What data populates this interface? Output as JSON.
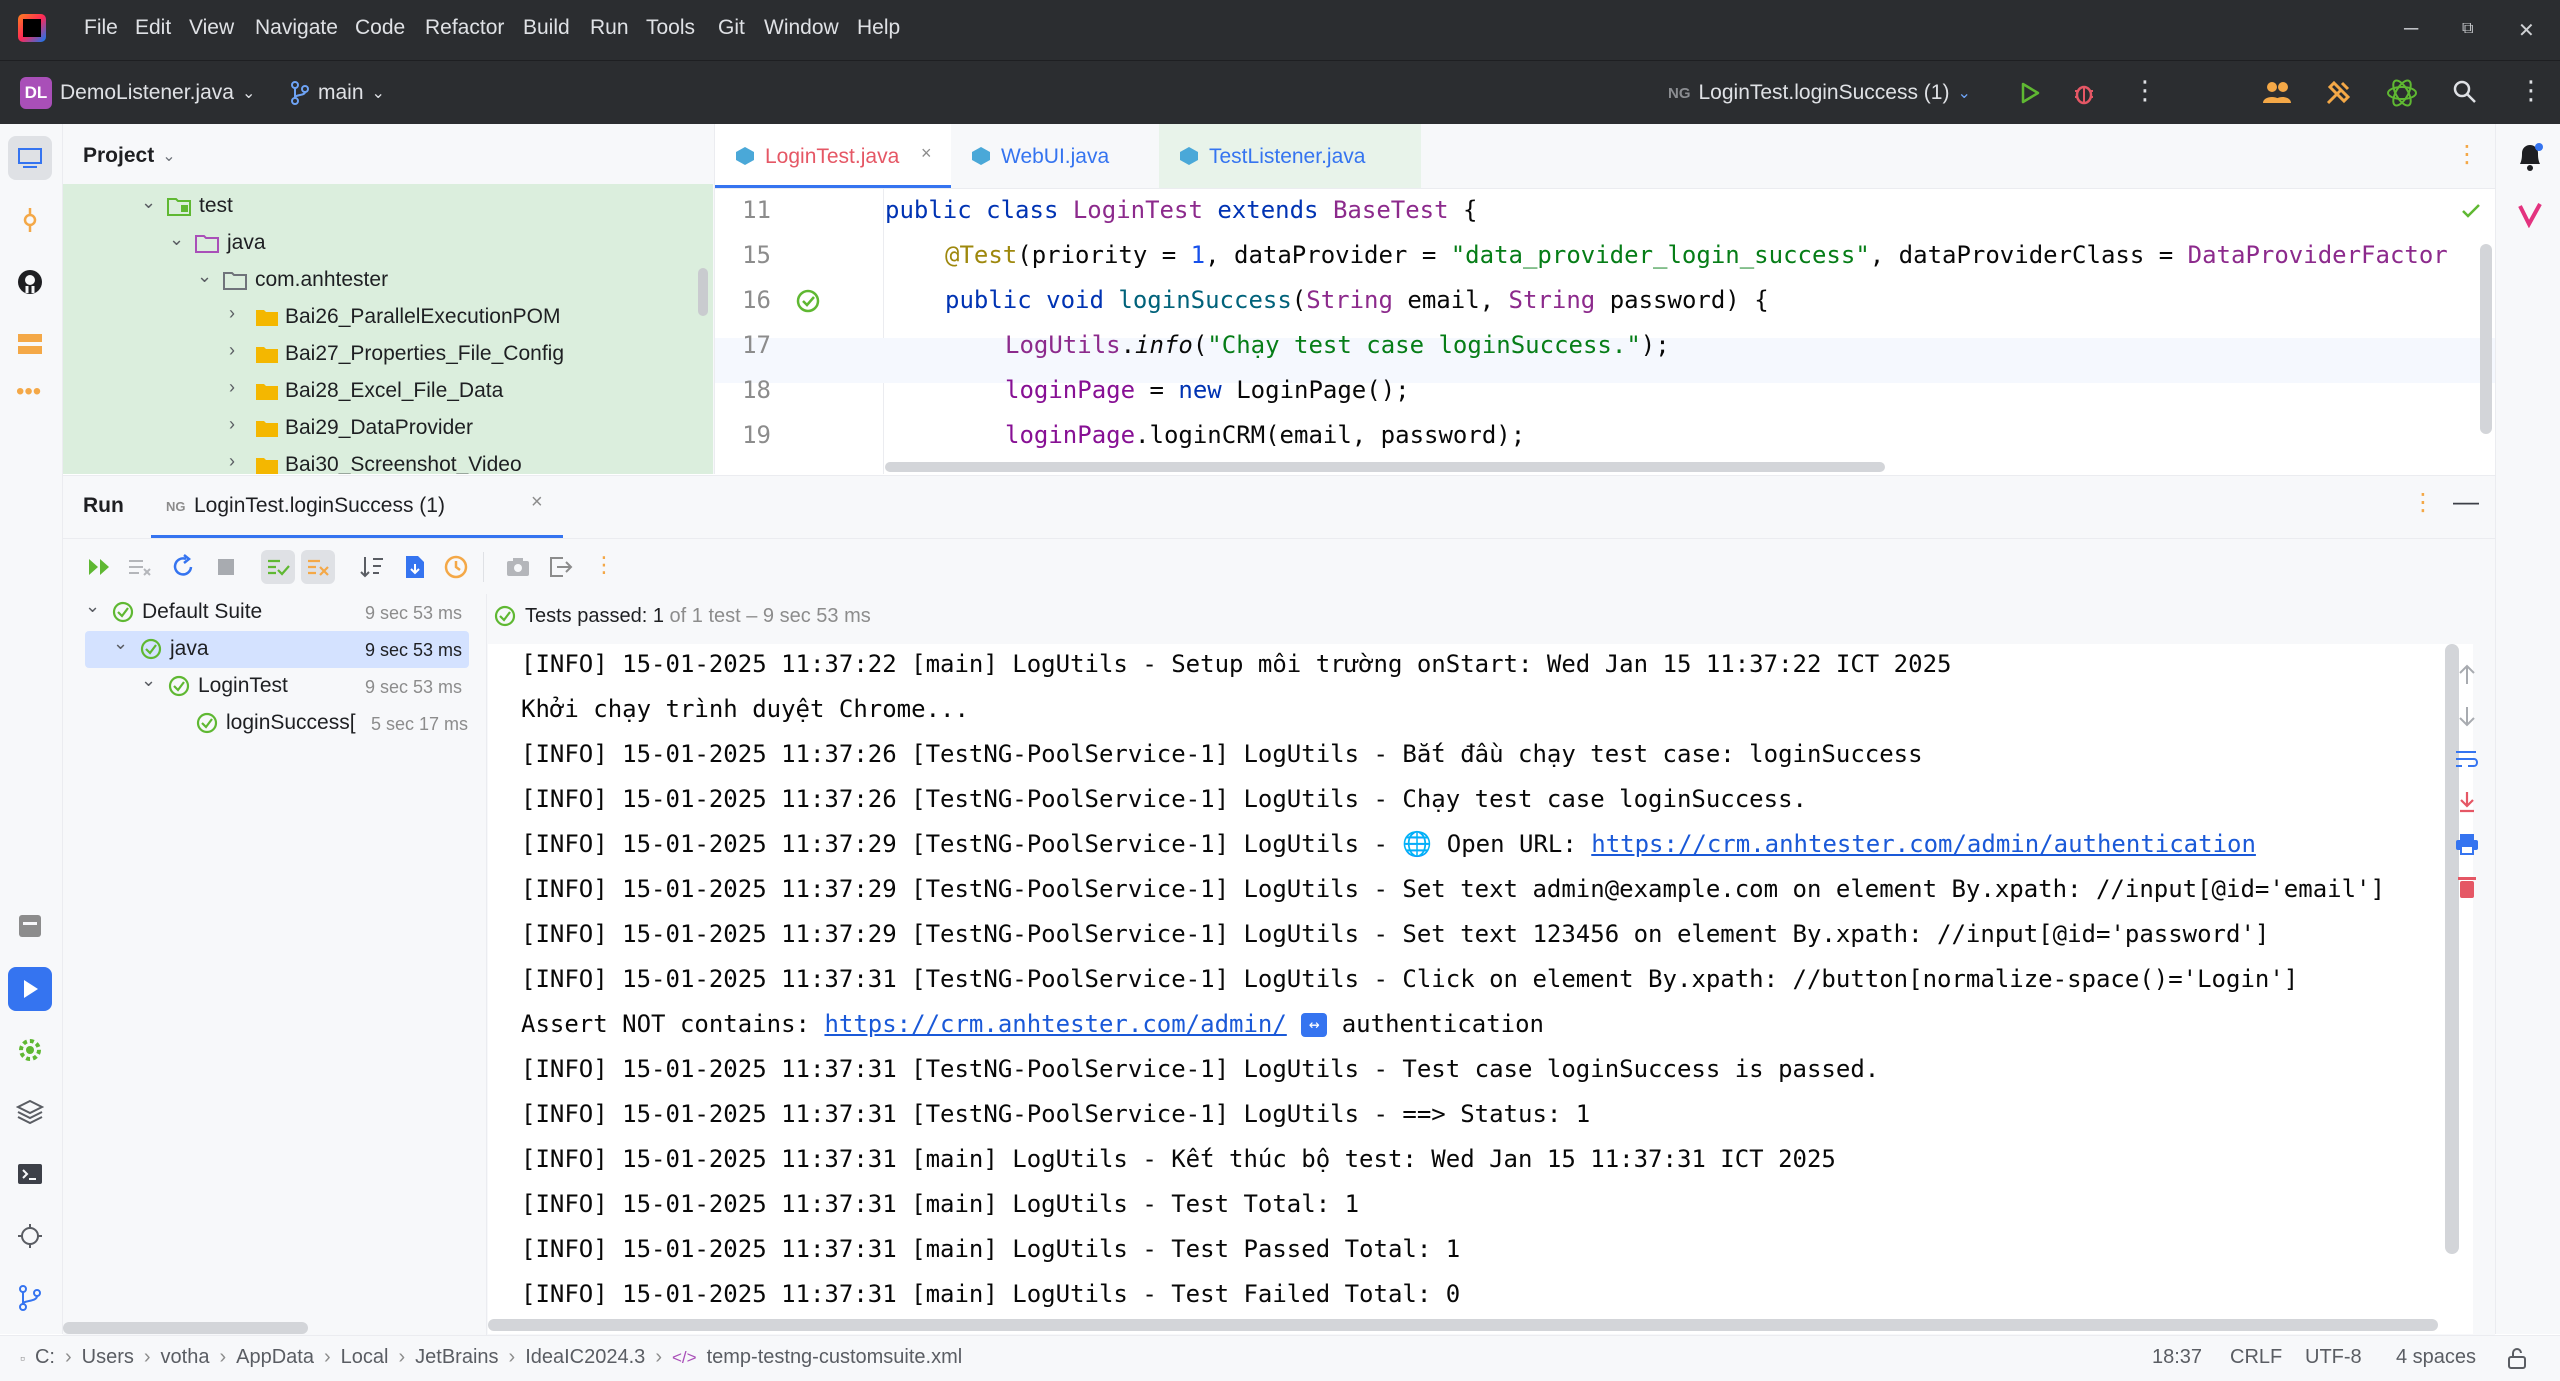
{
  "menubar": {
    "items": [
      "File",
      "Edit",
      "View",
      "Navigate",
      "Code",
      "Refactor",
      "Build",
      "Run",
      "Tools",
      "Git",
      "Window",
      "Help"
    ]
  },
  "toolbar": {
    "project_badge": "DL",
    "project_name": "DemoListener.java",
    "branch": "main",
    "run_config": "LoginTest.loginSuccess (1)"
  },
  "project_panel": {
    "title": "Project",
    "rows": [
      {
        "label": "test",
        "kind": "test-root"
      },
      {
        "label": "java",
        "kind": "src-folder"
      },
      {
        "label": "com.anhtester",
        "kind": "package"
      },
      {
        "label": "Bai26_ParallelExecutionPOM",
        "kind": "folder"
      },
      {
        "label": "Bai27_Properties_File_Config",
        "kind": "folder"
      },
      {
        "label": "Bai28_Excel_File_Data",
        "kind": "folder"
      },
      {
        "label": "Bai29_DataProvider",
        "kind": "folder"
      },
      {
        "label": "Bai30_Screenshot_Video",
        "kind": "folder"
      }
    ]
  },
  "editor": {
    "tabs": [
      {
        "label": "LoginTest.java",
        "active": true
      },
      {
        "label": "WebUI.java",
        "active": false
      },
      {
        "label": "TestListener.java",
        "active": false
      }
    ],
    "lines": [
      {
        "num": "11"
      },
      {
        "num": "15"
      },
      {
        "num": "16"
      },
      {
        "num": "17"
      },
      {
        "num": "18"
      },
      {
        "num": "19"
      }
    ],
    "code": {
      "l11_kw1": "public",
      "l11_kw2": "class",
      "l11_cls": "LoginTest",
      "l11_kw3": "extends",
      "l11_cls2": "BaseTest",
      "l11_tail": " {",
      "l15_ann": "@Test",
      "l15_a": "(priority = ",
      "l15_num": "1",
      "l15_b": ", dataProvider = ",
      "l15_str": "\"data_provider_login_success\"",
      "l15_c": ", dataProviderClass = ",
      "l15_cls": "DataProviderFactor",
      "l16_kw1": "public",
      "l16_kw2": "void",
      "l16_fn": "loginSuccess",
      "l16_a": "(",
      "l16_t1": "String",
      "l16_b": " email, ",
      "l16_t2": "String",
      "l16_c": " password) {",
      "l17_cls": "LogUtils",
      "l17_a": ".",
      "l17_m": "info",
      "l17_b": "(",
      "l17_str": "\"Chạy test case loginSuccess.\"",
      "l17_c": ");",
      "l18_fld": "loginPage",
      "l18_a": " = ",
      "l18_kw": "new",
      "l18_b": " LoginPage();",
      "l19_fld": "loginPage",
      "l19_a": ".loginCRM(email, password);"
    }
  },
  "run_panel": {
    "title": "Run",
    "tab_label": "LoginTest.loginSuccess (1)",
    "summary_prefix": "Tests passed: ",
    "summary_count": "1",
    "summary_suffix": " of 1 test – 9 sec 53 ms",
    "tree": [
      {
        "label": "Default Suite",
        "time": "9 sec 53 ms",
        "level": 0,
        "selected": false
      },
      {
        "label": "java",
        "time": "9 sec 53 ms",
        "level": 1,
        "selected": true
      },
      {
        "label": "LoginTest",
        "time": "9 sec 53 ms",
        "level": 2,
        "selected": false
      },
      {
        "label": "loginSuccess[",
        "time": "5 sec 17 ms",
        "level": 3,
        "selected": false
      }
    ],
    "console": {
      "l1": "[INFO] 15-01-2025 11:37:22 [main] LogUtils - Setup môi trường onStart: Wed Jan 15 11:37:22 ICT 2025",
      "l2": "Khởi chạy trình duyệt Chrome...",
      "l3": "[INFO] 15-01-2025 11:37:26 [TestNG-PoolService-1] LogUtils - Bắt đầu chạy test case: loginSuccess",
      "l4": "[INFO] 15-01-2025 11:37:26 [TestNG-PoolService-1] LogUtils - Chạy test case loginSuccess.",
      "l5_pre": "[INFO] 15-01-2025 11:37:29 [TestNG-PoolService-1] LogUtils - ",
      "l5_mid": " Open URL: ",
      "l5_url": "https://crm.anhtester.com/admin/authentication",
      "l6": "[INFO] 15-01-2025 11:37:29 [TestNG-PoolService-1] LogUtils - Set text admin@example.com on element By.xpath: //input[@id='email']",
      "l7": "[INFO] 15-01-2025 11:37:29 [TestNG-PoolService-1] LogUtils - Set text 123456 on element By.xpath: //input[@id='password']",
      "l8": "[INFO] 15-01-2025 11:37:31 [TestNG-PoolService-1] LogUtils - Click on element By.xpath: //button[normalize-space()='Login']",
      "l9_pre": "Assert NOT contains: ",
      "l9_url": "https://crm.anhtester.com/admin/",
      "l9_post": " authentication",
      "l10": "[INFO] 15-01-2025 11:37:31 [TestNG-PoolService-1] LogUtils - Test case loginSuccess is passed.",
      "l11": "[INFO] 15-01-2025 11:37:31 [TestNG-PoolService-1] LogUtils - ==> Status: 1",
      "l12": "[INFO] 15-01-2025 11:37:31 [main] LogUtils - Kết thúc bộ test: Wed Jan 15 11:37:31 ICT 2025",
      "l13": "[INFO] 15-01-2025 11:37:31 [main] LogUtils - Test Total: 1",
      "l14": "[INFO] 15-01-2025 11:37:31 [main] LogUtils - Test Passed Total: 1",
      "l15": "[INFO] 15-01-2025 11:37:31 [main] LogUtils - Test Failed Total: 0"
    }
  },
  "statusbar": {
    "path": [
      "C:",
      "Users",
      "votha",
      "AppData",
      "Local",
      "JetBrains",
      "IdeaIC2024.3",
      "temp-testng-customsuite.xml"
    ],
    "position": "18:37",
    "line_sep": "CRLF",
    "encoding": "UTF-8",
    "indent": "4 spaces"
  },
  "colors": {
    "dark_chrome": "#2b2d30",
    "accent_blue": "#3574f0",
    "pass_green": "#5fb832",
    "tree_green": "#dbeedd"
  }
}
